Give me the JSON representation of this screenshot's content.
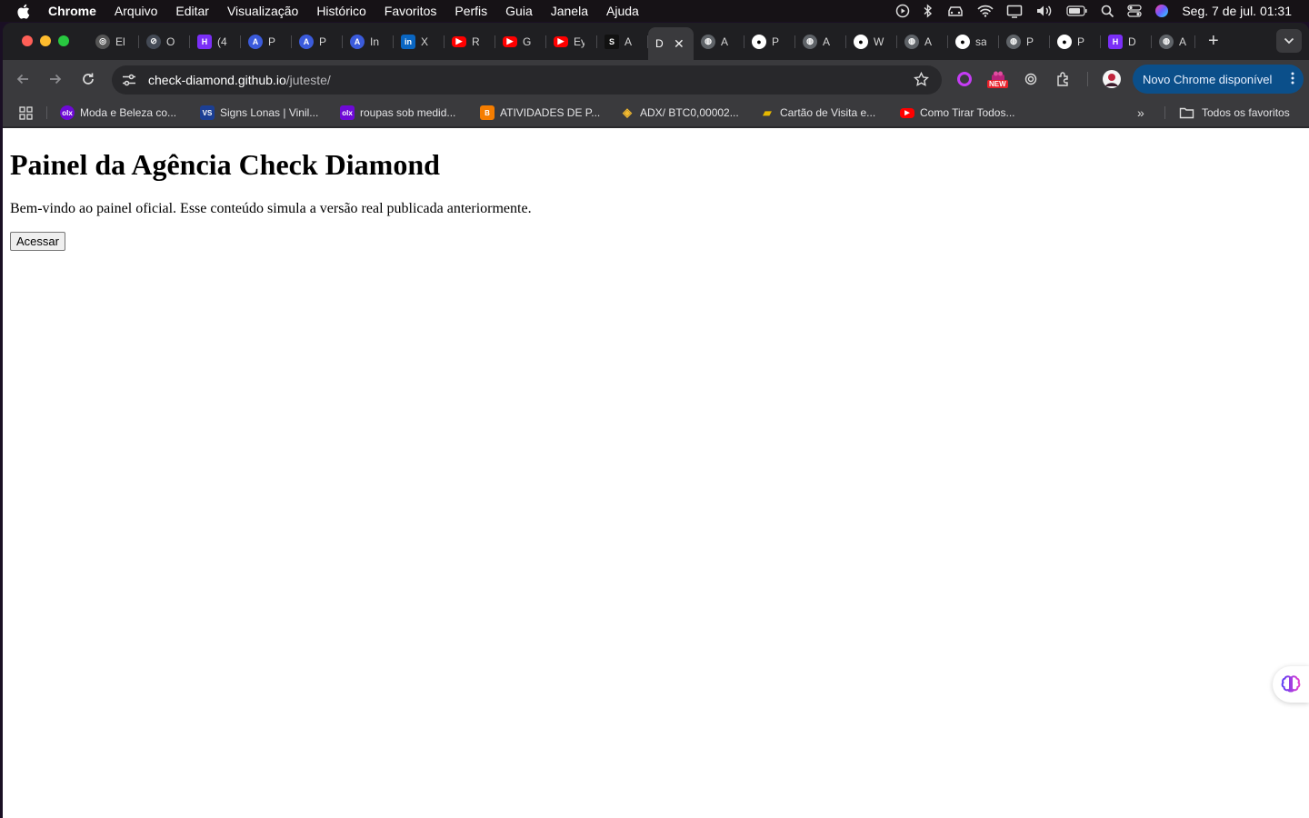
{
  "menubar": {
    "app": "Chrome",
    "items": [
      "Arquivo",
      "Editar",
      "Visualização",
      "Histórico",
      "Favoritos",
      "Perfis",
      "Guia",
      "Janela",
      "Ajuda"
    ],
    "clock": "Seg. 7 de jul.  01:31"
  },
  "tabs": [
    {
      "title": "El",
      "icon": "globe-spiral-icon",
      "color": "#555555"
    },
    {
      "title": "O",
      "icon": "compass-icon",
      "color": "#444a55"
    },
    {
      "title": "(4",
      "icon": "grid-h-icon",
      "color": "#7b2ff7"
    },
    {
      "title": "P",
      "icon": "a-logo-icon",
      "color": "#3b5bdb"
    },
    {
      "title": "P",
      "icon": "a-logo-icon",
      "color": "#3b5bdb"
    },
    {
      "title": "In",
      "icon": "a-logo-icon",
      "color": "#3b5bdb"
    },
    {
      "title": "X",
      "icon": "linkedin-icon",
      "color": "#0a66c2"
    },
    {
      "title": "R",
      "icon": "youtube-icon",
      "color": "#ff0000"
    },
    {
      "title": "G",
      "icon": "youtube-icon",
      "color": "#ff0000"
    },
    {
      "title": "Ey",
      "icon": "youtube-icon",
      "color": "#ff0000"
    },
    {
      "title": "A",
      "icon": "s-logo-icon",
      "color": "#111111"
    }
  ],
  "active_tab": {
    "title": "D"
  },
  "tabs_after": [
    {
      "title": "A",
      "icon": "globe-icon"
    },
    {
      "title": "P",
      "icon": "github-icon"
    },
    {
      "title": "A",
      "icon": "globe-icon"
    },
    {
      "title": "W",
      "icon": "github-icon"
    },
    {
      "title": "A",
      "icon": "globe-icon"
    },
    {
      "title": "sa",
      "icon": "github-icon"
    },
    {
      "title": "P",
      "icon": "globe-icon"
    },
    {
      "title": "P",
      "icon": "github-icon"
    },
    {
      "title": "D",
      "icon": "grid-h-icon"
    },
    {
      "title": "A",
      "icon": "globe-icon"
    }
  ],
  "address": {
    "host": "check-diamond.github.io",
    "path": "/juteste/"
  },
  "extensions": {
    "new_badge": "NEW"
  },
  "update_button": "Novo Chrome disponível",
  "bookmarks": [
    {
      "label": "Moda e Beleza co...",
      "icon": "olx-icon",
      "color": "#6e0ad6"
    },
    {
      "label": "Signs Lonas | Vinil...",
      "icon": "vs-logo-icon",
      "color": "#1c3f94"
    },
    {
      "label": "roupas sob medid...",
      "icon": "olx-icon",
      "color": "#6e0ad6"
    },
    {
      "label": "ATIVIDADES DE P...",
      "icon": "blogger-icon",
      "color": "#f57d00"
    },
    {
      "label": "ADX/ BTC0,00002...",
      "icon": "binance-icon",
      "color": "#f3ba2f"
    },
    {
      "label": "Cartão de Visita e...",
      "icon": "card-icon",
      "color": "#e6b800"
    },
    {
      "label": "Como Tirar Todos...",
      "icon": "youtube-icon",
      "color": "#ff0000"
    }
  ],
  "all_bookmarks": "Todos os favoritos",
  "page": {
    "heading": "Painel da Agência Check Diamond",
    "paragraph": "Bem-vindo ao painel oficial. Esse conteúdo simula a versão real publicada anteriormente.",
    "button": "Acessar"
  }
}
